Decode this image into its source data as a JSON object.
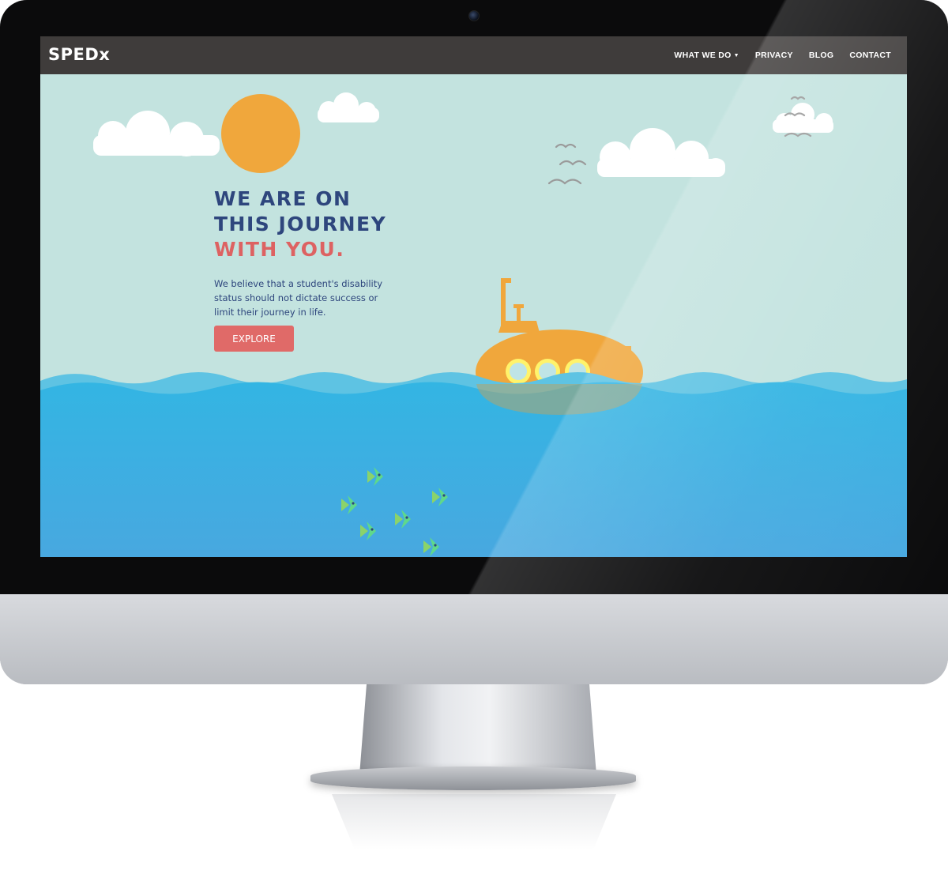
{
  "navbar": {
    "brand": "SPEDx",
    "items": [
      {
        "label": "WHAT WE DO",
        "has_dropdown": true
      },
      {
        "label": "PRIVACY"
      },
      {
        "label": "BLOG"
      },
      {
        "label": "CONTACT"
      }
    ]
  },
  "hero": {
    "headline_line1": "WE ARE ON",
    "headline_line2": "THIS JOURNEY",
    "headline_line3": "WITH YOU.",
    "body": "We believe that a student's disability status should not dictate success or limit their journey in life.",
    "cta_label": "EXPLORE"
  },
  "icons": {
    "dropdown": "caret-down-icon",
    "illustration": [
      "sun",
      "clouds",
      "birds",
      "submarine",
      "waves",
      "fish"
    ]
  },
  "colors": {
    "navbar_bg": "#3f3c3b",
    "sky": "#c3e3df",
    "sea": "#3fb2e0",
    "sun": "#f0a73c",
    "headline_blue": "#2e467d",
    "headline_red": "#dd6262",
    "button": "#e06a68",
    "fish": "#5fd88b"
  }
}
